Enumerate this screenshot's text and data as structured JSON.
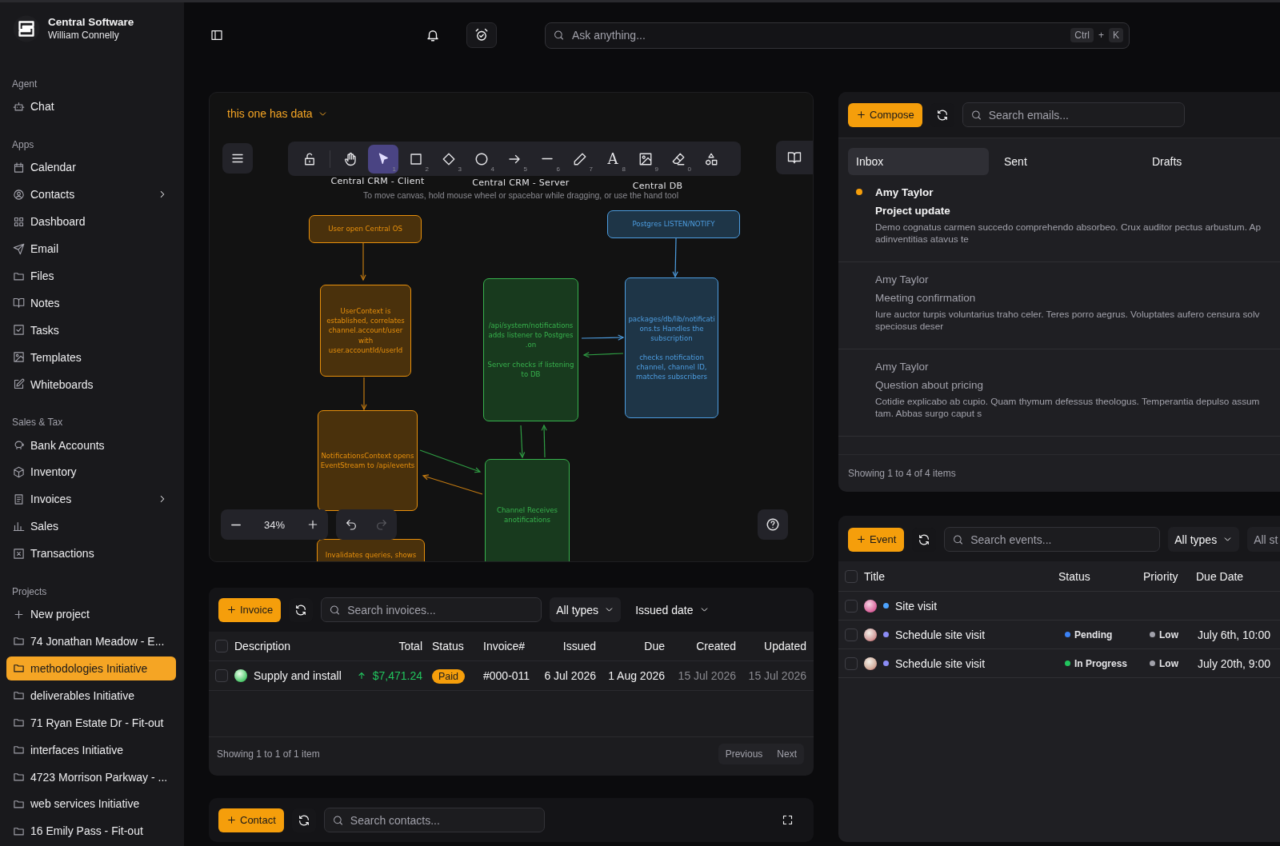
{
  "sidebar": {
    "brand": "Central Software",
    "user": "William Connelly",
    "sections": [
      {
        "heading": "Agent",
        "items": [
          {
            "label": "Chat",
            "selected": false,
            "has_submenu": false
          }
        ]
      },
      {
        "heading": "Apps",
        "items": [
          {
            "label": "Calendar",
            "selected": false,
            "has_submenu": false
          },
          {
            "label": "Contacts",
            "selected": false,
            "has_submenu": true
          },
          {
            "label": "Dashboard",
            "selected": false,
            "has_submenu": false
          },
          {
            "label": "Email",
            "selected": false,
            "has_submenu": false
          },
          {
            "label": "Files",
            "selected": false,
            "has_submenu": false
          },
          {
            "label": "Notes",
            "selected": false,
            "has_submenu": false
          },
          {
            "label": "Tasks",
            "selected": false,
            "has_submenu": false
          },
          {
            "label": "Templates",
            "selected": false,
            "has_submenu": false
          },
          {
            "label": "Whiteboards",
            "selected": false,
            "has_submenu": false
          }
        ]
      },
      {
        "heading": "Sales & Tax",
        "items": [
          {
            "label": "Bank Accounts",
            "selected": false,
            "has_submenu": false
          },
          {
            "label": "Inventory",
            "selected": false,
            "has_submenu": false
          },
          {
            "label": "Invoices",
            "selected": false,
            "has_submenu": true
          },
          {
            "label": "Sales",
            "selected": false,
            "has_submenu": false
          },
          {
            "label": "Transactions",
            "selected": false,
            "has_submenu": false
          }
        ]
      },
      {
        "heading": "Projects",
        "items": [
          {
            "label": "New project",
            "kind": "action",
            "selected": false
          },
          {
            "label": "74 Jonathan Meadow - E...",
            "kind": "project",
            "selected": false
          },
          {
            "label": "methodologies Initiative",
            "kind": "project",
            "selected": true
          },
          {
            "label": "deliverables Initiative",
            "kind": "project",
            "selected": false
          },
          {
            "label": "71 Ryan Estate Dr - Fit-out",
            "kind": "project",
            "selected": false
          },
          {
            "label": "interfaces Initiative",
            "kind": "project",
            "selected": false
          },
          {
            "label": "4723 Morrison Parkway - ...",
            "kind": "project",
            "selected": false
          },
          {
            "label": "web services Initiative",
            "kind": "project",
            "selected": false
          },
          {
            "label": "16 Emily Pass - Fit-out",
            "kind": "project",
            "selected": false
          }
        ]
      }
    ]
  },
  "topbar": {
    "search_placeholder": "Ask anything...",
    "shortcut": {
      "modifier": "Ctrl",
      "joiner": "+",
      "key": "K"
    }
  },
  "whiteboard": {
    "title": "this one has data",
    "tools": [
      {
        "selected": false
      },
      {
        "selected": false
      },
      {
        "shortcut": "1",
        "selected": true
      },
      {
        "shortcut": "2",
        "selected": false
      },
      {
        "shortcut": "3",
        "selected": false
      },
      {
        "shortcut": "4",
        "selected": false
      },
      {
        "shortcut": "5",
        "selected": false
      },
      {
        "shortcut": "6",
        "selected": false
      },
      {
        "shortcut": "7",
        "selected": false
      },
      {
        "glyph": "A",
        "shortcut": "8",
        "selected": false
      },
      {
        "shortcut": "9",
        "selected": false
      },
      {
        "shortcut": "0",
        "selected": false
      },
      {
        "selected": false
      }
    ],
    "zoom": "34%",
    "hint": "To move canvas, hold mouse wheel or spacebar while dragging, or use the hand tool",
    "lanes": [
      "Central CRM - Client",
      "Central CRM - Server",
      "Central DB"
    ],
    "nodes": [
      {
        "color": "#4d9de0",
        "paragraphs": [
          "Postgres LISTEN/NOTIFY"
        ]
      },
      {
        "color": "#e8900c",
        "paragraphs": [
          "User open Central OS"
        ]
      },
      {
        "color": "#e8900c",
        "paragraphs": [
          "UserContext is established, correlates channel.account/user with user.accountId/userId"
        ]
      },
      {
        "color": "#37b24d",
        "paragraphs": [
          "/api/system/notifications adds listener to Postgres .on",
          "Server checks if listening to DB"
        ]
      },
      {
        "color": "#4d9de0",
        "paragraphs": [
          "packages/db/lib/notifications.ts Handles the subscription",
          "checks notification channel, channel ID, matches subscribers"
        ]
      },
      {
        "color": "#e8900c",
        "paragraphs": [
          "NotificationsContext opens EventStream to /api/events"
        ]
      },
      {
        "color": "#37b24d",
        "paragraphs": [
          "Channel Receives anotifications"
        ]
      },
      {
        "color": "#e8900c",
        "paragraphs": [
          "Invalidates queries, shows"
        ]
      }
    ]
  },
  "invoices": {
    "new_label": "Invoice",
    "search_placeholder": "Search invoices...",
    "filters": [
      "All types",
      "Issued date"
    ],
    "columns": [
      "Description",
      "Total",
      "Status",
      "Invoice#",
      "Issued",
      "Due",
      "Created",
      "Updated"
    ],
    "all_checked": false,
    "rows": [
      {
        "checked": false,
        "description": "Supply and install",
        "rising": true,
        "total": "$7,471.24",
        "status": "Paid",
        "number": "#000-011",
        "issued": "6 Jul 2026",
        "due": "1 Aug 2026",
        "created": "15 Jul 2026",
        "updated": "15 Jul 2026"
      }
    ],
    "footer": "Showing 1 to 1 of 1 item",
    "pager": [
      "Previous",
      "Next"
    ]
  },
  "contacts": {
    "new_label": "Contact",
    "search_placeholder": "Search contacts..."
  },
  "email": {
    "new_label": "Compose",
    "search_placeholder": "Search emails...",
    "tabs": [
      {
        "label": "Inbox",
        "selected": true
      },
      {
        "label": "Sent",
        "selected": false
      },
      {
        "label": "Drafts",
        "selected": false
      }
    ],
    "messages": [
      {
        "unread": true,
        "sender": "Amy Taylor",
        "subject": "Project update",
        "preview": [
          "Demo cognatus carmen succedo comprehendo absorbeo. Crux auditor pectus arbustum. Ap",
          "adinventitias atavus te"
        ]
      },
      {
        "unread": false,
        "sender": "Amy Taylor",
        "subject": "Meeting confirmation",
        "preview": [
          "Iure auctor turpis voluntarius traho celer. Teres porro aegrus. Voluptates aufero censura solv",
          "speciosus deser"
        ]
      },
      {
        "unread": false,
        "sender": "Amy Taylor",
        "subject": "Question about pricing",
        "preview": [
          "Cotidie explicabo ab cupio. Quam thymum defessus theologus. Temperantia depulso assum",
          "tam. Abbas surgo caput s"
        ]
      }
    ],
    "footer": "Showing 1 to 4 of 4 items"
  },
  "events": {
    "new_label": "Event",
    "search_placeholder": "Search events...",
    "filters": [
      "All types",
      "All st"
    ],
    "columns": [
      "Title",
      "Status",
      "Priority",
      "Due Date"
    ],
    "all_checked": false,
    "rows": [
      {
        "checked": false,
        "color": "#4da3ff",
        "title": "Site visit"
      },
      {
        "checked": false,
        "color": "#8b8cf6",
        "title": "Schedule site visit",
        "status": {
          "label": "Pending",
          "color": "#3b82f6"
        },
        "priority": {
          "label": "Low",
          "color": "#a1a1aa"
        },
        "due": "July 6th, 10:00"
      },
      {
        "checked": false,
        "color": "#8b8cf6",
        "title": "Schedule site visit",
        "status": {
          "label": "In Progress",
          "color": "#22c55e"
        },
        "priority": {
          "label": "Low",
          "color": "#a1a1aa"
        },
        "due": "July 20th, 9:00"
      }
    ]
  }
}
